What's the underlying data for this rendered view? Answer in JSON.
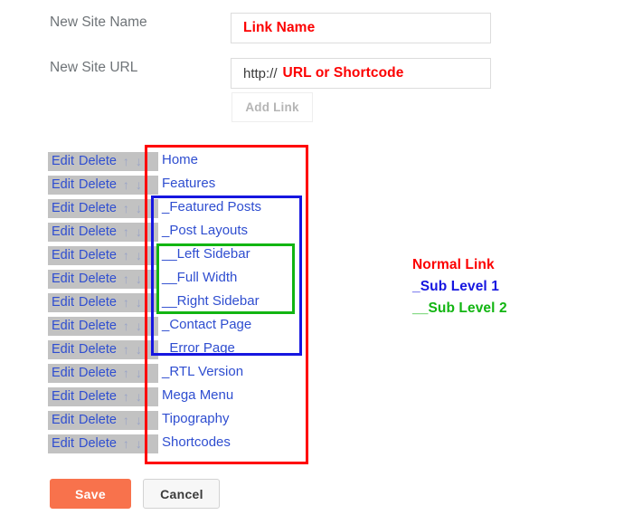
{
  "form": {
    "rows": [
      {
        "label": "New Site Name",
        "value": "Link Name",
        "prefix": ""
      },
      {
        "label": "New Site URL",
        "value": "URL or Shortcode",
        "prefix": "http://"
      }
    ],
    "add_link_label": "Add Link"
  },
  "list": {
    "row_actions": {
      "edit": "Edit",
      "delete": "Delete",
      "move_up": "↑",
      "move_down": "↓"
    },
    "items": [
      {
        "name": "Home",
        "level": 1
      },
      {
        "name": "Features",
        "level": 1
      },
      {
        "name": "_Featured Posts",
        "level": 2
      },
      {
        "name": "_Post Layouts",
        "level": 2
      },
      {
        "name": "__Left Sidebar",
        "level": 3
      },
      {
        "name": "__Full Width",
        "level": 3
      },
      {
        "name": "__Right Sidebar",
        "level": 3
      },
      {
        "name": "_Contact Page",
        "level": 2
      },
      {
        "name": "_Error Page",
        "level": 2
      },
      {
        "name": "_RTL Version",
        "level": 2
      },
      {
        "name": "Mega Menu",
        "level": 1
      },
      {
        "name": "Tipography",
        "level": 1
      },
      {
        "name": "Shortcodes",
        "level": 1
      }
    ]
  },
  "legend": {
    "lines": [
      {
        "text": "Normal Link",
        "color": "#fc0000"
      },
      {
        "text": "_Sub Level 1",
        "color": "#1616e0"
      },
      {
        "text": "__Sub Level 2",
        "color": "#12b512"
      }
    ]
  },
  "footer": {
    "save_label": "Save",
    "cancel_label": "Cancel"
  },
  "colors": {
    "normal_link": "#fc0000",
    "sub_level_1": "#1616e0",
    "sub_level_2": "#12b512",
    "save_button": "#f8724c",
    "row_background": "#c2c2c2",
    "link_text": "#2f4ed0"
  }
}
